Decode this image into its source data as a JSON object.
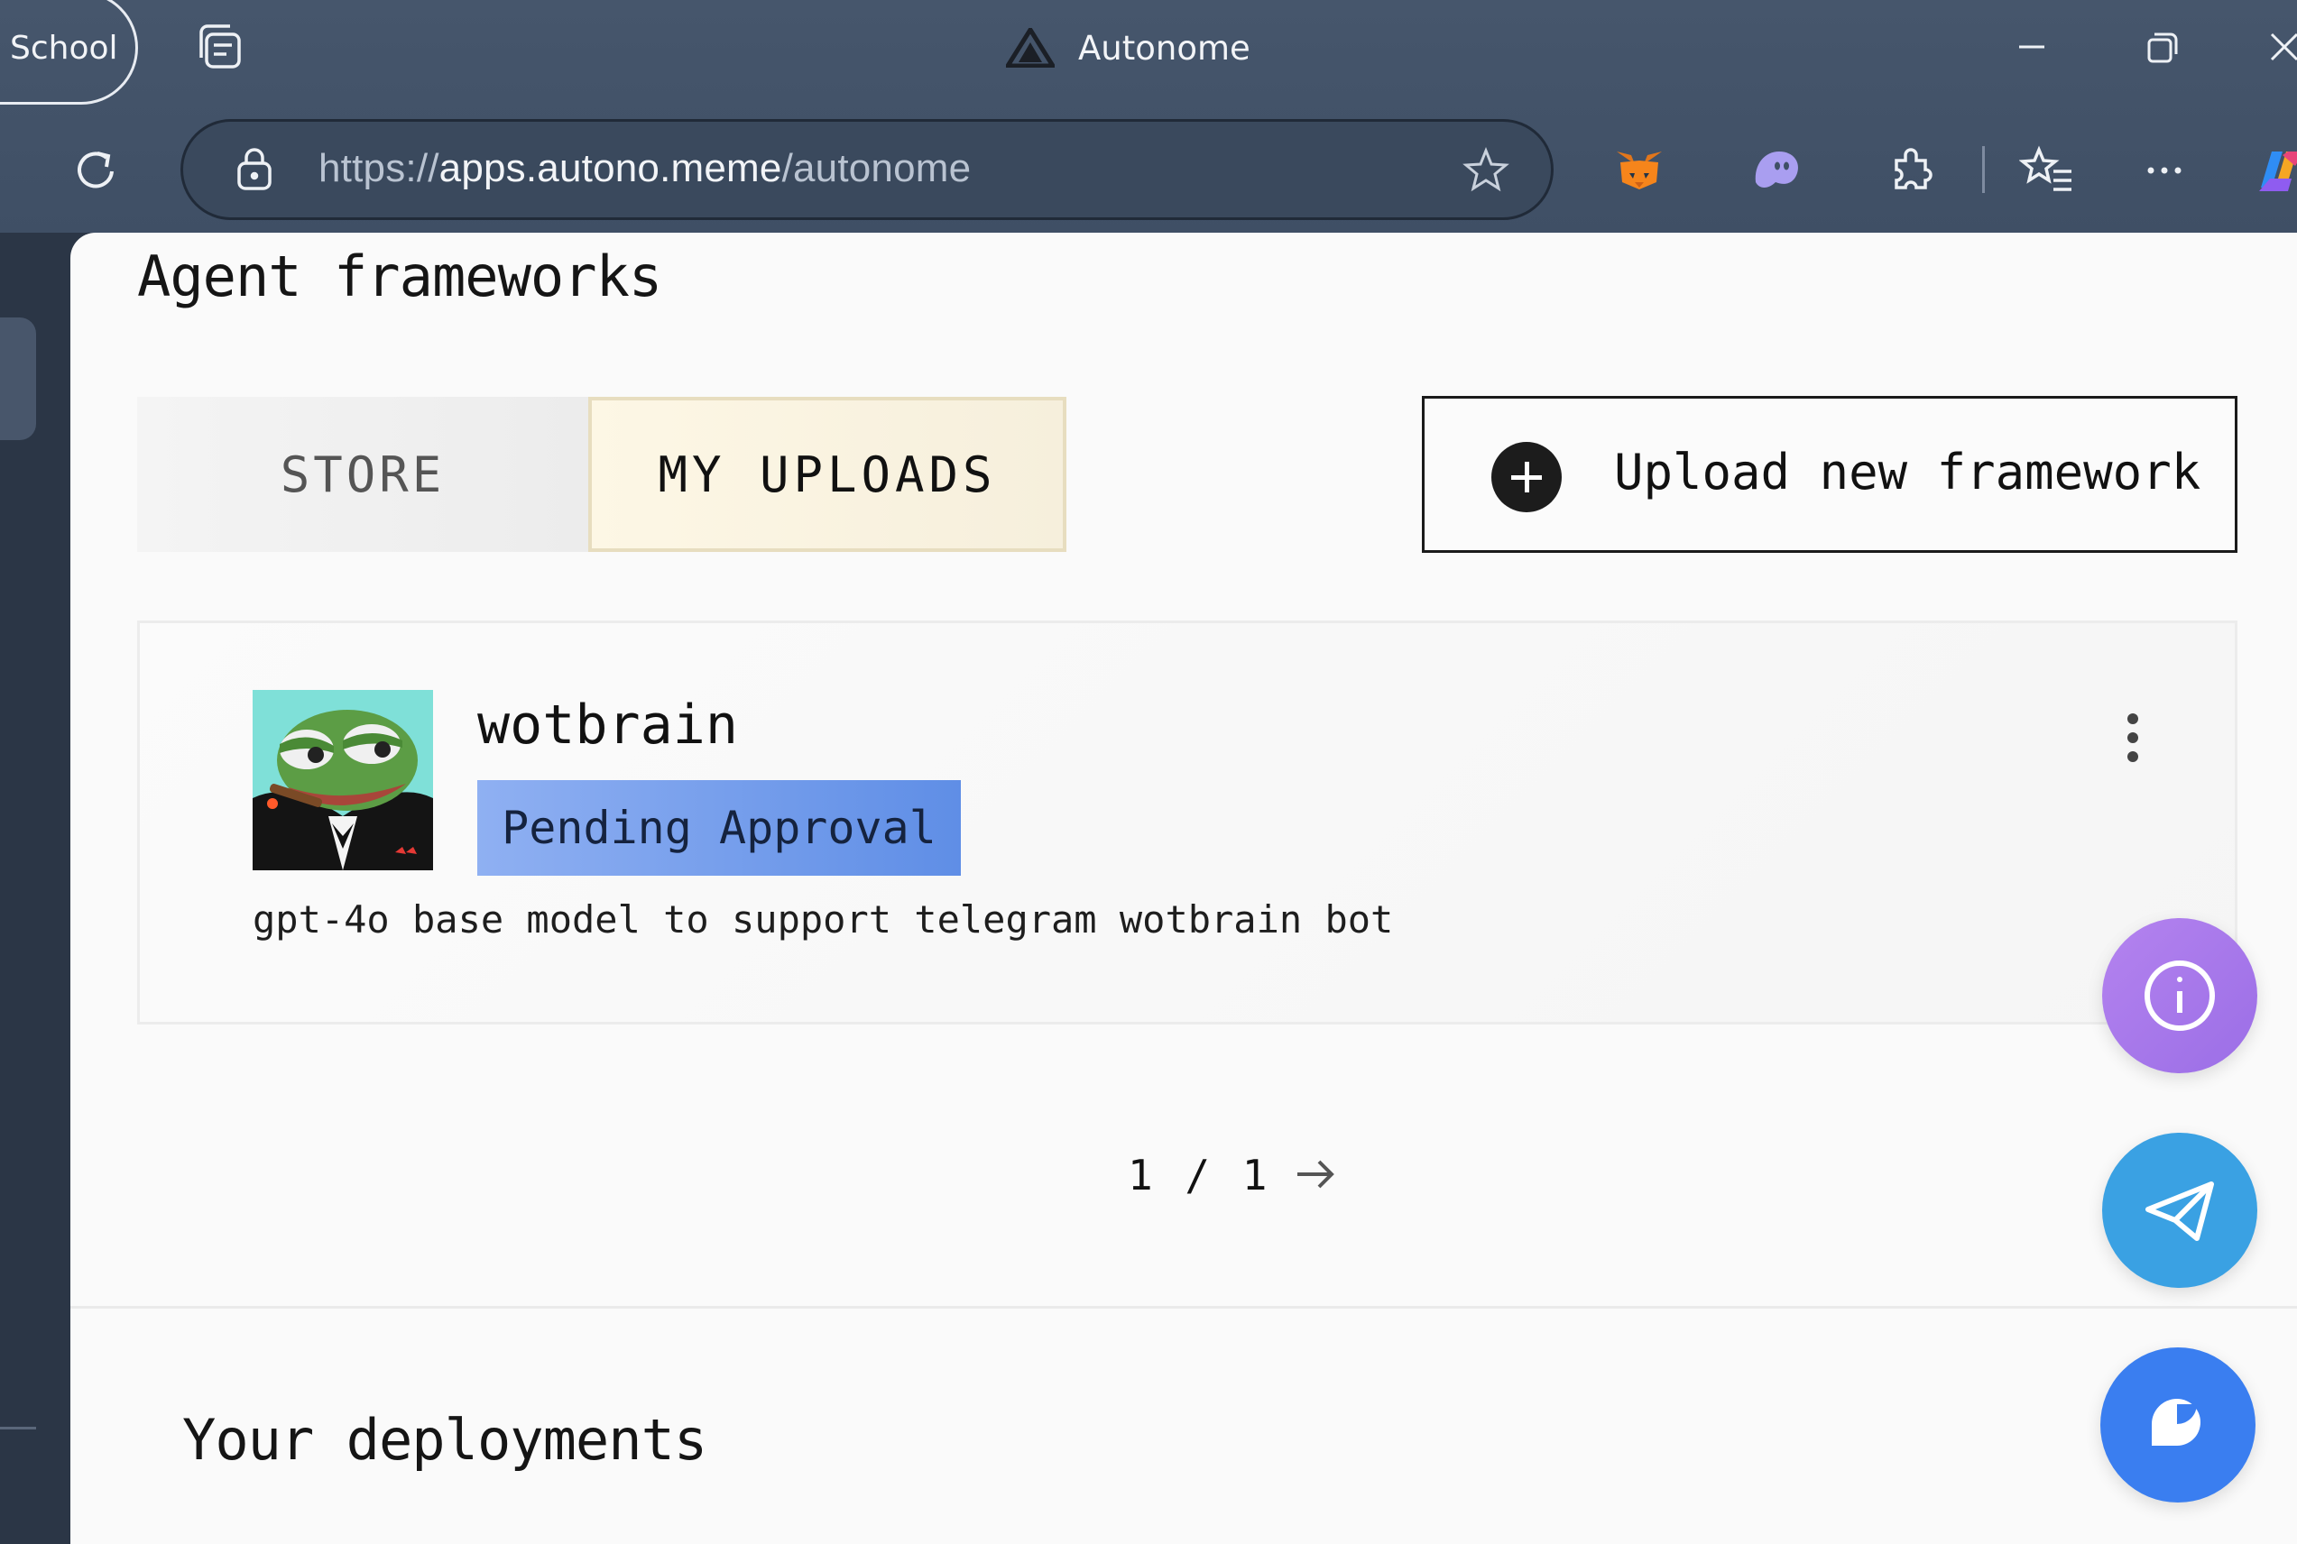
{
  "browser": {
    "profile_label": "School",
    "window_title": "Autonome",
    "url_prefix": "https://",
    "url_host": "apps.autono.meme",
    "url_path": "/autonome",
    "icons": [
      "tabs-icon",
      "autonome-logo-icon",
      "minimize-icon",
      "restore-icon",
      "close-icon",
      "reload-icon",
      "lock-icon",
      "favorite-star-icon",
      "metamask-icon",
      "ghost-extension-icon",
      "extensions-icon",
      "favorites-icon",
      "more-icon",
      "copilot-icon"
    ]
  },
  "main": {
    "section_title": "Agent frameworks",
    "tabs": [
      {
        "label": "STORE",
        "active": false
      },
      {
        "label": "MY UPLOADS",
        "active": true
      }
    ],
    "upload_button_label": "Upload new framework",
    "frameworks": [
      {
        "name": "wotbrain",
        "status": "Pending Approval",
        "description": "gpt-4o base model to support telegram wotbrain bot"
      }
    ],
    "pagination": "1 / 1",
    "deployments_title": "Your deployments"
  },
  "colors": {
    "chrome": "#46566c",
    "panel": "#fafafa",
    "active_tab": "#fdf7e5",
    "badge": "#6e9aeb",
    "fab_info": "#a97ae9",
    "fab_telegram": "#3aa1e3",
    "fab_chat": "#3a7ef0"
  }
}
